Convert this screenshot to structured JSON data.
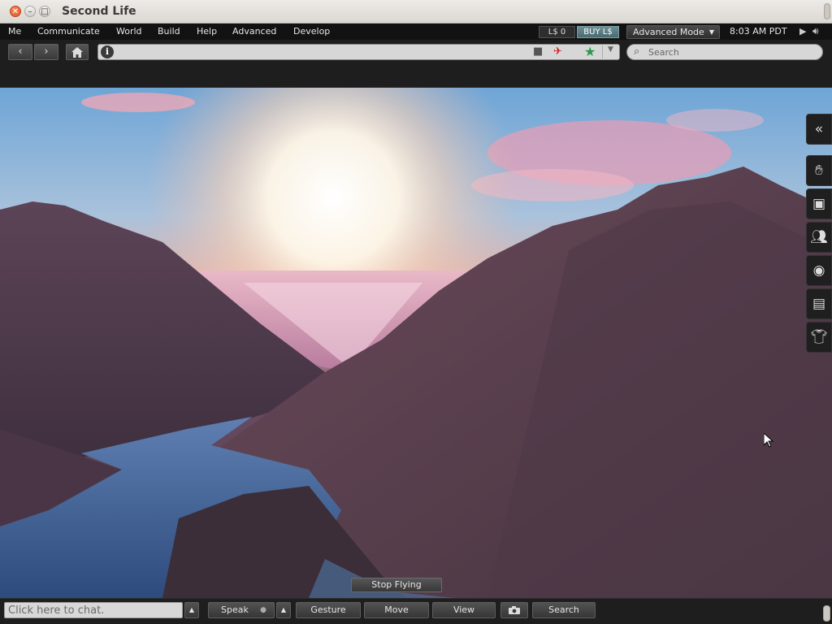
{
  "window": {
    "title": "Second Life"
  },
  "menubar": {
    "items": [
      "Me",
      "Communicate",
      "World",
      "Build",
      "Help",
      "Advanced",
      "Develop"
    ],
    "balance": "L$ 0",
    "buy_label": "BUY L$",
    "mode_label": "Advanced Mode",
    "time": "8:03 AM PDT"
  },
  "navbar": {
    "location_value": "",
    "search_placeholder": "Search"
  },
  "viewport": {
    "stop_flying_label": "Stop Flying"
  },
  "sidebar": {
    "tabs": [
      "collapse",
      "home",
      "me",
      "people",
      "places",
      "inventory",
      "appearance"
    ]
  },
  "bottombar": {
    "chat_placeholder": "Click here to chat.",
    "speak_label": "Speak",
    "gesture_label": "Gesture",
    "move_label": "Move",
    "view_label": "View",
    "search_label": "Search"
  },
  "icons": {
    "back": "chevron-left",
    "forward": "chevron-right",
    "home": "house",
    "info": "info-circle",
    "favorite": "star",
    "search": "magnifier",
    "snapshot": "camera",
    "volume": "speaker"
  },
  "colors": {
    "menubar": "#121212",
    "toolbar": "#1e1e1e",
    "buy_button": "#5b7e83",
    "favorite_star": "#2a9a4a"
  }
}
